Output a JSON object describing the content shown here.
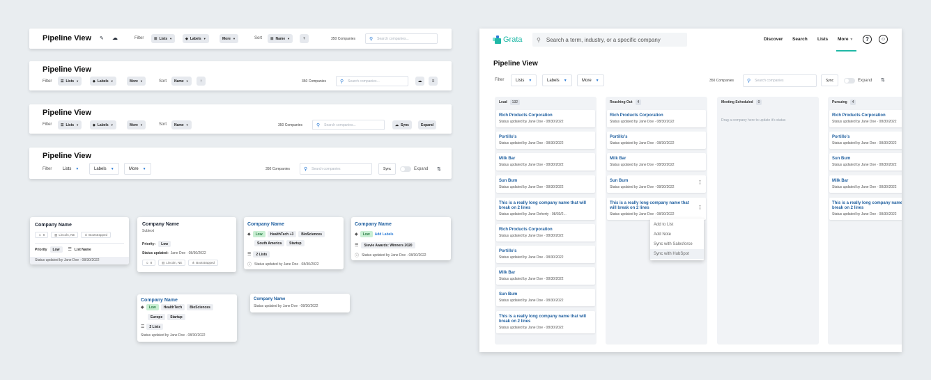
{
  "variants": {
    "title": "Pipeline View",
    "filter": "Filter",
    "sort": "Sort",
    "lists": "Lists",
    "labels": "Labels",
    "more": "More",
    "name": "Name",
    "count": "350 Companies",
    "search_placeholder": "Search companies...",
    "search_placeholder_alt": "Search companies",
    "sync": "Sync",
    "expand": "Expand"
  },
  "cards": {
    "company": "Company Name",
    "subtext": "Subtext",
    "priority": "Priority",
    "priority_colon": "Priority:",
    "low": "Low",
    "list_name": "List Name",
    "status_updated": "Status updated:",
    "status_date": "Jane Doe · 08/30/2022",
    "status_line": "Status updated by Jane Doe · 08/30/2022",
    "count8": "8",
    "location": "Lincoln, NE",
    "bootstrapped": "Bootstrapped",
    "healthtech3": "HealthTech +3",
    "healthtech": "HealthTech",
    "biosciences": "BioSciences",
    "south_america": "South America",
    "europe": "Europe",
    "startup": "Startup",
    "two_lists": "2 Lists",
    "add_labels": "Add Labels",
    "award": "Stevie Awards: Winners 2020"
  },
  "app": {
    "brand": "Grata",
    "search_placeholder": "Search a term, industry, or a specific company",
    "nav": [
      "Discover",
      "Search",
      "Lists",
      "More"
    ],
    "page_title": "Pipeline View",
    "filter": "Filter",
    "lists": "Lists",
    "labels": "Labels",
    "more": "More",
    "count": "350 Companies",
    "search_companies": "Search companies",
    "sync": "Sync",
    "expand": "Expand",
    "columns": [
      {
        "name": "Lead",
        "count": "132"
      },
      {
        "name": "Reaching Out",
        "count": "4"
      },
      {
        "name": "Meeting Scheduled",
        "count": "0"
      },
      {
        "name": "Pursuing",
        "count": "4"
      }
    ],
    "empty_hint": "Drag a company here to update it's status",
    "companies": {
      "rich": "Rich Products Corporation",
      "portillos": "Portillo's",
      "milk": "Milk Bar",
      "sun": "Sun Bum",
      "long": "This is a really long company name that will break on 2 lines"
    },
    "status": "Status updated by Jane Doe · 08/30/2022",
    "status_doherty": "Status updated by Jane Doherty · 08/30/2...",
    "menu": [
      "Add to List",
      "Add Note",
      "Sync with Salesforce",
      "Sync with HubSpot"
    ]
  },
  "colors": {
    "accent": "#2a7bd6",
    "brand": "#1fb8a6",
    "low": "#c9efd3"
  }
}
